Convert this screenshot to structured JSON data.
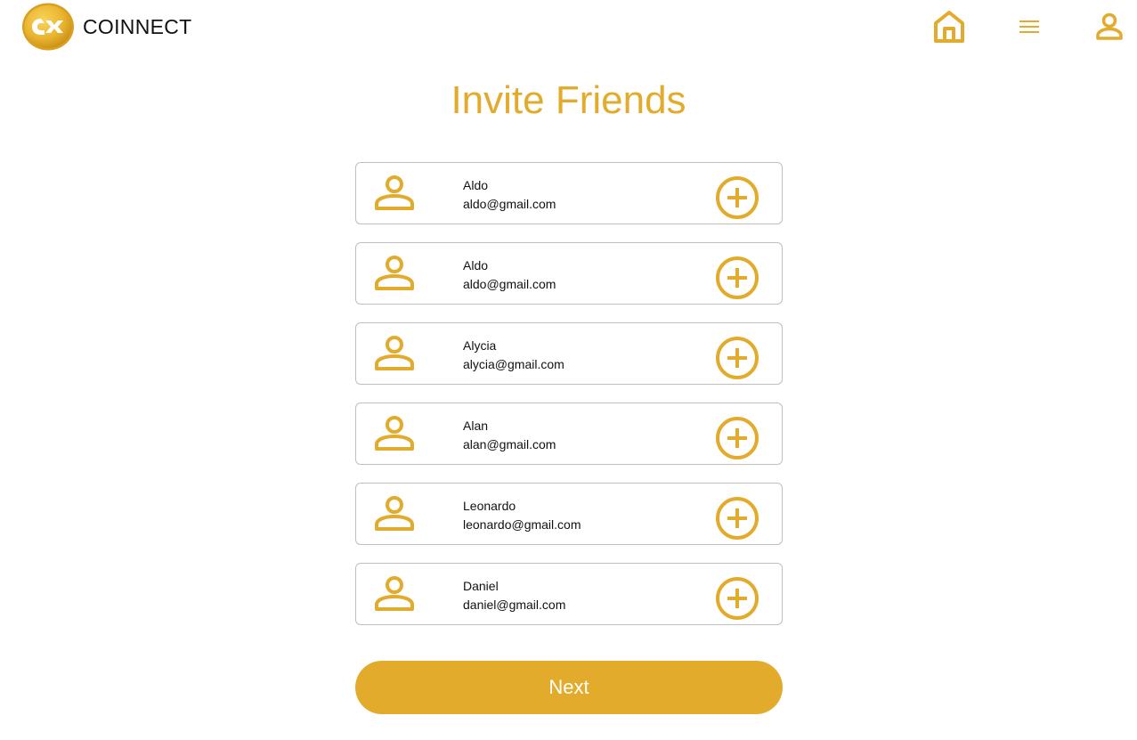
{
  "header": {
    "brand": "COINNECT",
    "logo_icon": "coinnect-logo",
    "nav": [
      {
        "name": "home",
        "icon": "home-icon"
      },
      {
        "name": "menu",
        "icon": "hamburger-menu-icon"
      },
      {
        "name": "profile",
        "icon": "user-icon"
      }
    ]
  },
  "page": {
    "title": "Invite Friends"
  },
  "friends": [
    {
      "name": "Aldo",
      "email": "aldo@gmail.com"
    },
    {
      "name": "Aldo",
      "email": "aldo@gmail.com"
    },
    {
      "name": "Alycia",
      "email": "alycia@gmail.com"
    },
    {
      "name": "Alan",
      "email": "alan@gmail.com"
    },
    {
      "name": "Leonardo",
      "email": "leonardo@gmail.com"
    },
    {
      "name": "Daniel",
      "email": "daniel@gmail.com"
    }
  ],
  "actions": {
    "next_label": "Next"
  },
  "colors": {
    "accent": "#e2ab2b",
    "card_border": "#bfbfbf",
    "text": "#111111"
  }
}
